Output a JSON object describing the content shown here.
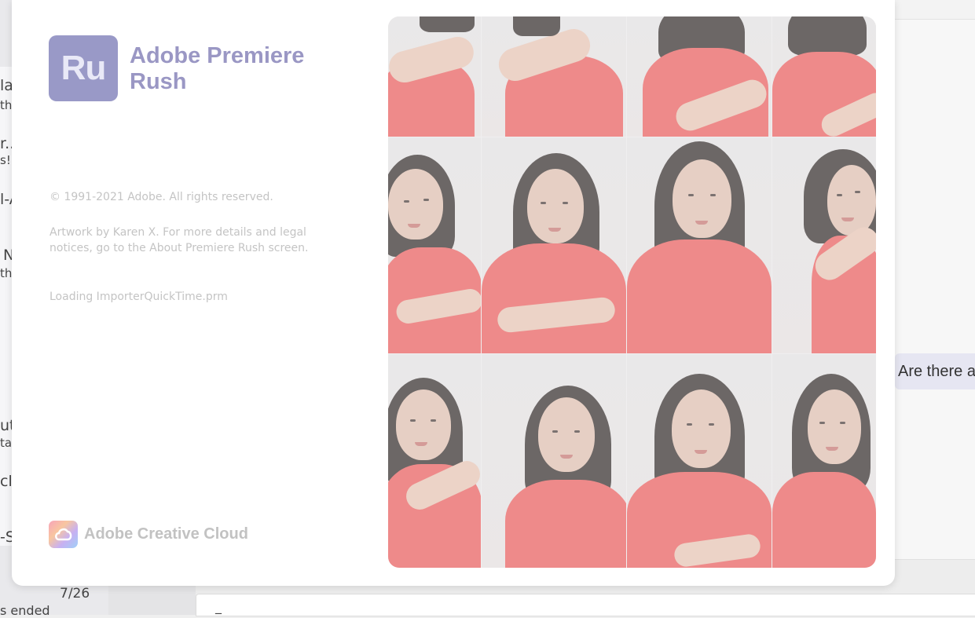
{
  "background_app": {
    "left_fragments": [
      "la",
      "th",
      "r..",
      "s!",
      "l-A",
      "N",
      "th",
      "ut",
      "tal",
      "cl",
      "-S",
      "7/26",
      "s ended"
    ],
    "chat_bubble": "Are there a",
    "compose_text": "_"
  },
  "splash": {
    "logo_text": "Ru",
    "app_name": "Adobe Premiere Rush",
    "copyright": "© 1991-2021 Adobe. All rights reserved.",
    "artwork_credit": "Artwork by Karen X. For more details and legal notices, go to the About Premiere Rush screen.",
    "loading_status": "Loading ImporterQuickTime.prm",
    "brand_label": "Adobe Creative Cloud"
  },
  "colors": {
    "logo_bg": "#9999c7",
    "app_name": "#9a97c4",
    "shirt": "#ee8a8a",
    "muted_text": "#c4c4c4"
  }
}
